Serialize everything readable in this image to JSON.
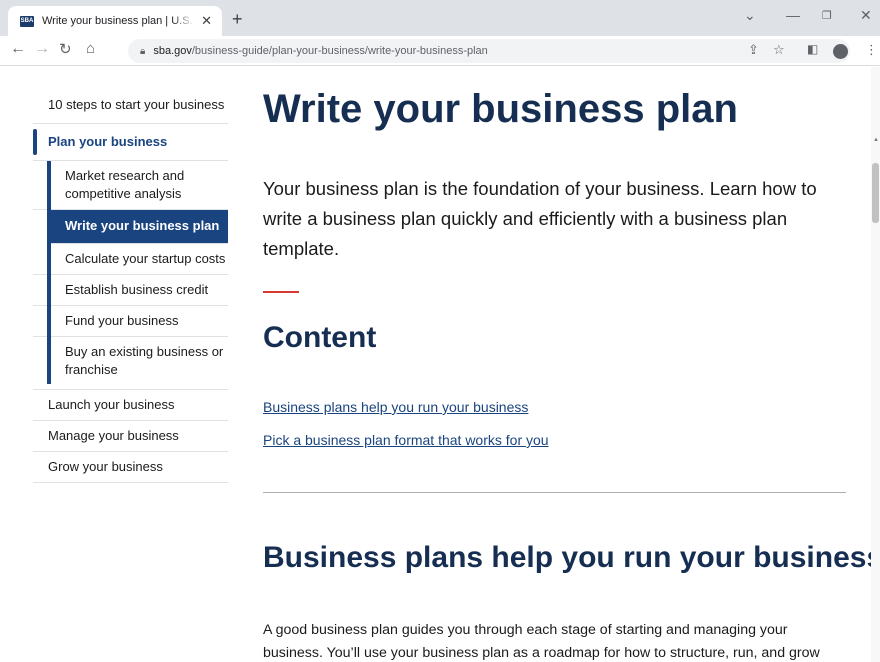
{
  "browser": {
    "tab_title": "Write your business plan | U.S. Sma",
    "favicon_text": "SBA",
    "url_host": "sba.gov",
    "url_path": "/business-guide/plan-your-business/write-your-business-plan"
  },
  "sidenav": {
    "top_item": "10 steps to start your business",
    "current_section": "Plan your business",
    "sub_items": [
      "Market research and competitive analysis",
      "Write your business plan",
      "Calculate your startup costs",
      "Establish business credit",
      "Fund your business",
      "Buy an existing business or franchise"
    ],
    "bottom_items": [
      "Launch your business",
      "Manage your business",
      "Grow your business"
    ]
  },
  "main": {
    "title": "Write your business plan",
    "lead": "Your business plan is the foundation of your business. Learn how to write a business plan quickly and efficiently with a business plan template.",
    "content_heading": "Content",
    "toc_links": [
      "Business plans help you run your business",
      "Pick a business plan format that works for you"
    ],
    "section_heading": "Business plans help you run your business",
    "section_body": "A good business plan guides you through each stage of starting and managing your business. You’ll use your business plan as a roadmap for how to structure, run, and grow"
  },
  "colors": {
    "heading": "#162e51",
    "accent": "#1a4480",
    "rule": "#d83933"
  }
}
